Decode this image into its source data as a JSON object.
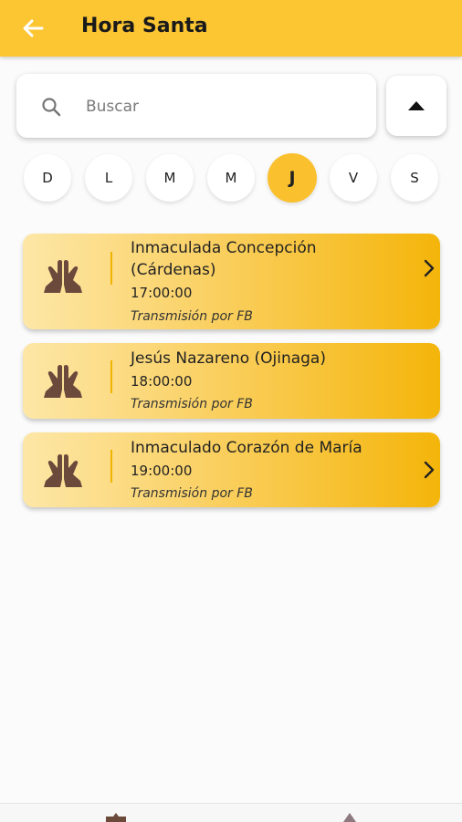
{
  "header": {
    "title": "Hora Santa",
    "back_icon": "arrow-left-icon"
  },
  "search": {
    "placeholder": "Buscar",
    "value": "",
    "icon": "search-icon"
  },
  "collapse_button": {
    "icon": "triangle-up-icon"
  },
  "days": [
    {
      "label": "D",
      "selected": false
    },
    {
      "label": "L",
      "selected": false
    },
    {
      "label": "M",
      "selected": false
    },
    {
      "label": "M",
      "selected": false
    },
    {
      "label": "J",
      "selected": true
    },
    {
      "label": "V",
      "selected": false
    },
    {
      "label": "S",
      "selected": false
    }
  ],
  "events": [
    {
      "name": "Inmaculada Concepción (Cárdenas)",
      "time": "17:00:00",
      "note": "Transmisión por FB",
      "icon": "praying-hands-icon",
      "has_chevron": true
    },
    {
      "name": "Jesús Nazareno (Ojinaga)",
      "time": "18:00:00",
      "note": "Transmisión por FB",
      "icon": "praying-hands-icon",
      "has_chevron": false
    },
    {
      "name": "Inmaculado Corazón de María",
      "time": "19:00:00",
      "note": "Transmisión por FB",
      "icon": "praying-hands-icon",
      "has_chevron": true
    }
  ],
  "colors": {
    "accent": "#fcc633",
    "card_start": "#fde7a7",
    "card_end": "#f4b50a",
    "icon_brown": "#6b4a3c"
  }
}
